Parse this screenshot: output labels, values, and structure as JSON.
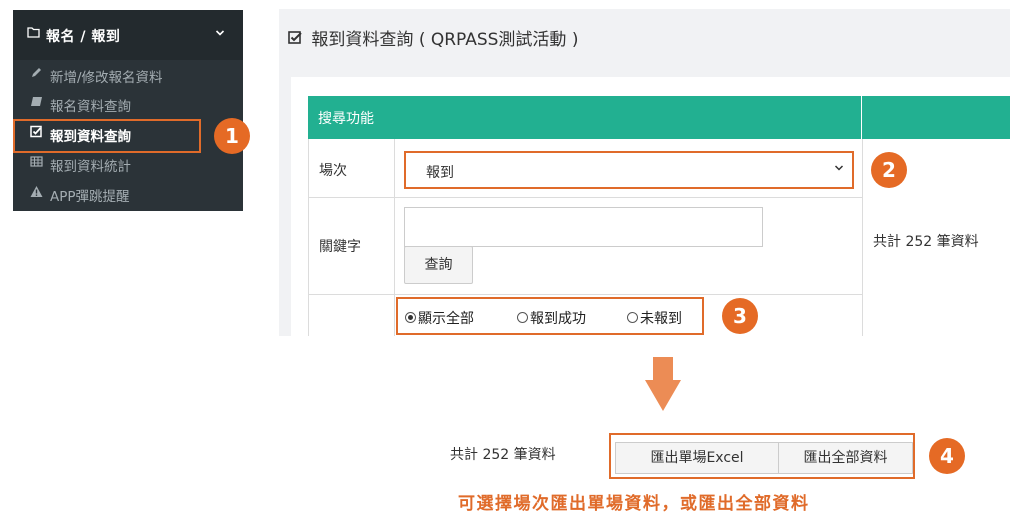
{
  "sidebar": {
    "header_title": "報名 / 報到",
    "items": [
      {
        "label": "新增/修改報名資料",
        "icon": "pencil-icon"
      },
      {
        "label": "報名資料查詢",
        "icon": "book-icon"
      },
      {
        "label": "報到資料查詢",
        "icon": "checkbox-icon"
      },
      {
        "label": "報到資料統計",
        "icon": "grid-icon"
      },
      {
        "label": "APP彈跳提醒",
        "icon": "warning-icon"
      }
    ]
  },
  "page": {
    "title": "報到資料查詢",
    "subtitle": "( QRPASS測試活動 )"
  },
  "search": {
    "header": "搜尋功能",
    "session_label": "場次",
    "session_value": "報到",
    "keyword_label": "關鍵字",
    "keyword_value": "",
    "search_button": "查詢",
    "filters": [
      {
        "label": "顯示全部",
        "selected": true
      },
      {
        "label": "報到成功",
        "selected": false
      },
      {
        "label": "未報到",
        "selected": false
      }
    ]
  },
  "total_text": "共計 252  筆資料",
  "export": {
    "single_button": "匯出單場Excel",
    "all_button": "匯出全部資料"
  },
  "caption": "可選擇場次匯出單場資料，或匯出全部資料",
  "steps": [
    "1",
    "2",
    "3",
    "4"
  ],
  "colors": {
    "accent": "#e06b2a",
    "badge": "#e56a25",
    "table_header": "#22b091",
    "sidebar_bg": "#2b3338",
    "arrow": "#ec8c55"
  }
}
